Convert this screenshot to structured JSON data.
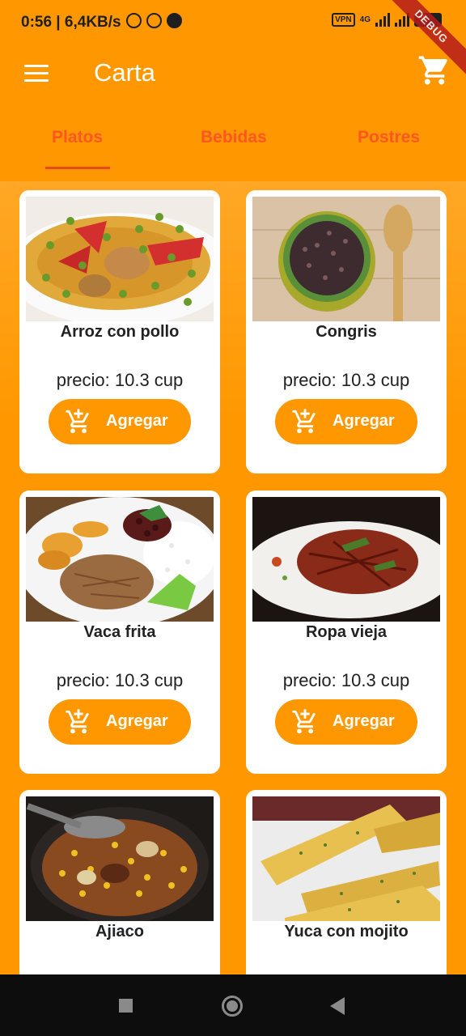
{
  "status": {
    "time": "0:56 | 6,4KB/s",
    "vpn": "VPN",
    "network": "4G",
    "battery": "60"
  },
  "debug_banner": "DEBUG",
  "appbar": {
    "title": "Carta",
    "menu_icon": "menu-icon",
    "cart_icon": "shopping-cart-icon"
  },
  "tabs": [
    {
      "label": "Platos",
      "selected": true
    },
    {
      "label": "Bebidas",
      "selected": false
    },
    {
      "label": "Postres",
      "selected": false
    }
  ],
  "accent_color": "#ff9800",
  "tab_color": "#ff5722",
  "dishes": [
    {
      "name": "Arroz con pollo",
      "price": "precio: 10.3 cup",
      "button": "Agregar"
    },
    {
      "name": "Congris",
      "price": "precio: 10.3 cup",
      "button": "Agregar"
    },
    {
      "name": "Vaca frita",
      "price": "precio: 10.3 cup",
      "button": "Agregar"
    },
    {
      "name": "Ropa vieja",
      "price": "precio: 10.3 cup",
      "button": "Agregar"
    },
    {
      "name": "Ajiaco",
      "price": "",
      "button": ""
    },
    {
      "name": "Yuca con mojito",
      "price": "",
      "button": ""
    }
  ]
}
